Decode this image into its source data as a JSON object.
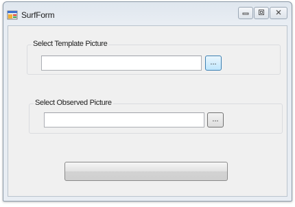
{
  "window": {
    "title": "SurfForm",
    "icon": "app-form-icon",
    "caption_buttons": {
      "minimize_glyph": "—",
      "maximize_glyph": "□",
      "close_glyph": "✕"
    }
  },
  "template_group": {
    "label": "Select Template Picture",
    "path_value": "",
    "browse_label": "..."
  },
  "observed_group": {
    "label": "Select Observed Picture",
    "path_value": "",
    "browse_label": "..."
  },
  "action_button": {
    "label": ""
  },
  "colors": {
    "client_background": "#f0f0f0",
    "focused_button": "#bee6fd"
  }
}
